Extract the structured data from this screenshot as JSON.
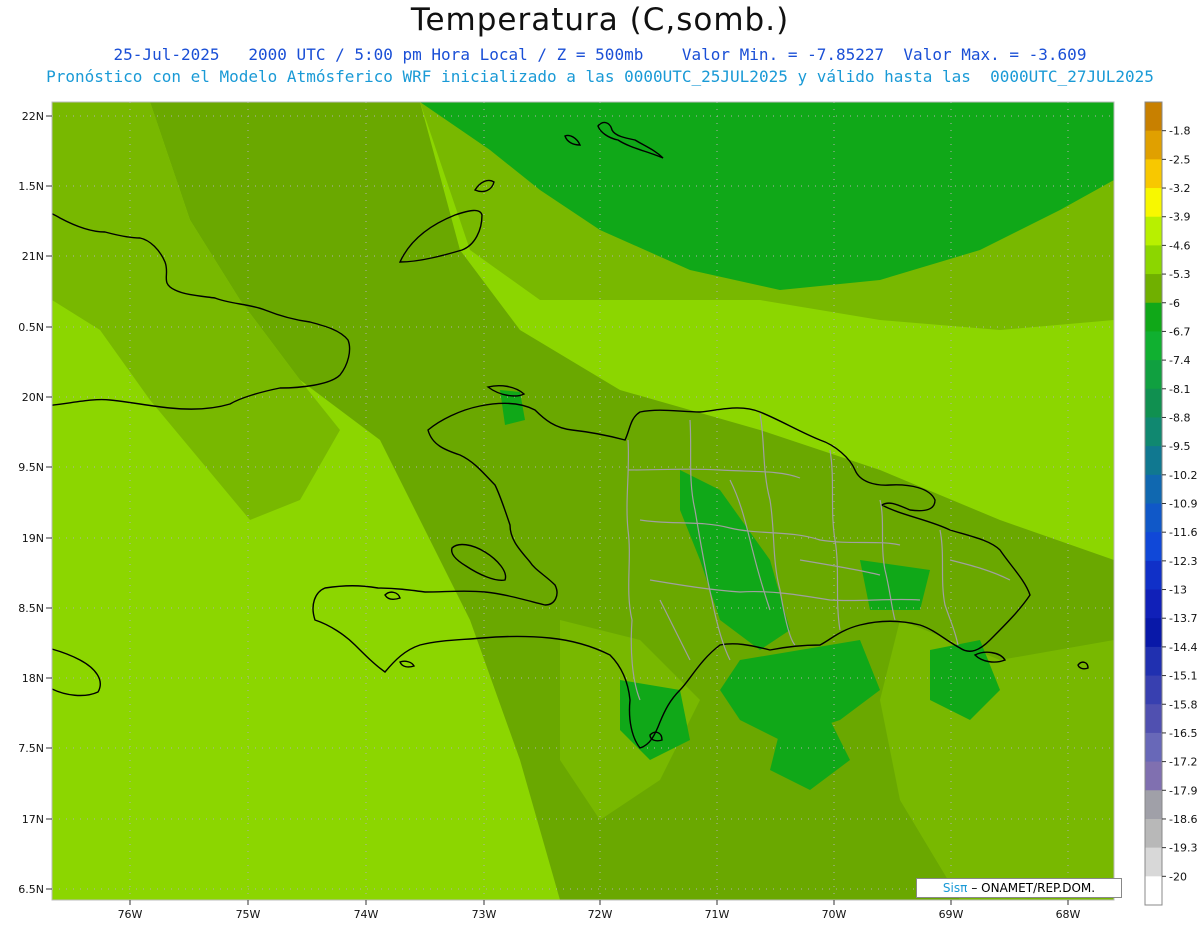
{
  "header": {
    "title": "Temperatura (C,somb.)",
    "line1": "25-Jul-2025   2000 UTC / 5:00 pm Hora Local / Z = 500mb    Valor Min. = -7.85227  Valor Max. = -3.609",
    "line2": "Pronóstico con el Modelo Atmósferico WRF inicializado a las 0000UTC_25JUL2025 y válido hasta las  0000UTC_27JUL2025"
  },
  "map": {
    "lat_labels": [
      "22N",
      "1.5N",
      "21N",
      "0.5N",
      "20N",
      "9.5N",
      "19N",
      "8.5N",
      "18N",
      "7.5N",
      "17N",
      "6.5N"
    ],
    "lon_labels": [
      "76W",
      "75W",
      "74W",
      "73W",
      "72W",
      "71W",
      "70W",
      "69W",
      "68W"
    ],
    "colors": {
      "lightest_green": "#8cd600",
      "medium_green": "#78b800",
      "olive_green": "#6aa800",
      "dark_green": "#10a818",
      "border": "#000000",
      "province_border": "#a0a0a0"
    }
  },
  "colorbar": {
    "labels": [
      "-1.8",
      "-2.5",
      "-3.2",
      "-3.9",
      "-4.6",
      "-5.3",
      "-6",
      "-6.7",
      "-7.4",
      "-8.1",
      "-8.8",
      "-9.5",
      "-10.2",
      "-10.9",
      "-11.6",
      "-12.3",
      "-13",
      "-13.7",
      "-14.4",
      "-15.1",
      "-15.8",
      "-16.5",
      "-17.2",
      "-17.9",
      "-18.6",
      "-19.3",
      "-20"
    ],
    "colors": [
      "#c88000",
      "#e0a000",
      "#f8c800",
      "#f8f800",
      "#b8f000",
      "#8cd600",
      "#70b000",
      "#10a818",
      "#10b030",
      "#10a040",
      "#109050",
      "#108870",
      "#107890",
      "#1068b0",
      "#1058c8",
      "#1048d8",
      "#1030c8",
      "#1020b8",
      "#0818a8",
      "#2030b0",
      "#3840b0",
      "#5050b0",
      "#6868b8",
      "#8070b0",
      "#a0a0a8",
      "#b8b8b8",
      "#d8d8d8",
      "#ffffff"
    ]
  },
  "credit": {
    "logo": "Sisπ",
    "text": "– ONAMET/REP.DOM."
  }
}
